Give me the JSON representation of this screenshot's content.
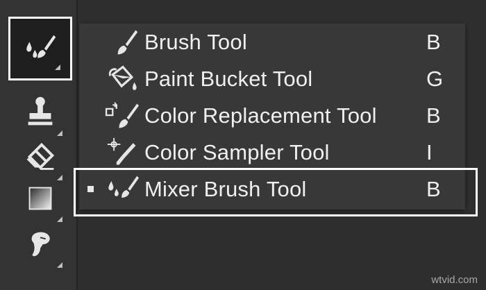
{
  "toolbar": {
    "tools": [
      {
        "icon": "mixer-brush-icon",
        "selected": true
      },
      {
        "icon": "clone-stamp-icon",
        "selected": false
      },
      {
        "icon": "eraser-icon",
        "selected": false
      },
      {
        "icon": "gradient-icon",
        "selected": false
      },
      {
        "icon": "smudge-finger-icon",
        "selected": false
      }
    ]
  },
  "menu": {
    "items": [
      {
        "label": "Brush Tool",
        "shortcut": "B",
        "icon": "brush-icon",
        "active": false
      },
      {
        "label": "Paint Bucket Tool",
        "shortcut": "G",
        "icon": "paint-bucket-icon",
        "active": false
      },
      {
        "label": "Color Replacement Tool",
        "shortcut": "B",
        "icon": "color-replacement-icon",
        "active": false
      },
      {
        "label": "Color Sampler Tool",
        "shortcut": "I",
        "icon": "color-sampler-icon",
        "active": false
      },
      {
        "label": "Mixer Brush Tool",
        "shortcut": "B",
        "icon": "mixer-brush-icon",
        "active": true
      }
    ]
  },
  "watermark": "wtvid.com",
  "colors": {
    "panel_bg": "#333333",
    "menu_bg": "#383838",
    "text": "#f0f0f0",
    "highlight_border": "#ffffff"
  }
}
